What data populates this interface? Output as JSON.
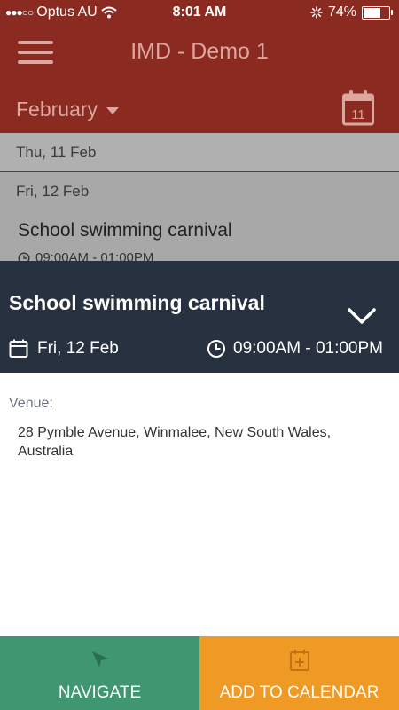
{
  "status_bar": {
    "carrier": "Optus AU",
    "time": "8:01 AM",
    "battery": "74%",
    "battery_level": 0.74
  },
  "header": {
    "title": "IMD - Demo 1",
    "month": "February",
    "calendar_day": "11"
  },
  "list": {
    "rows": [
      {
        "date": "Thu, 11 Feb"
      },
      {
        "date": "Fri, 12 Feb"
      }
    ],
    "event_title": "School swimming carnival",
    "event_time": "09:00AM - 01:00PM"
  },
  "detail": {
    "title": "School swimming carnival",
    "date": "Fri, 12 Feb",
    "time": "09:00AM - 01:00PM",
    "venue_label": "Venue:",
    "venue": "28 Pymble Avenue, Winmalee, New South Wales, Australia"
  },
  "actions": {
    "navigate": "NAVIGATE",
    "add_to_calendar": "ADD TO CALENDAR"
  },
  "colors": {
    "header_bg": "#8a2a20",
    "panel_bg": "#28313f",
    "navigate_bg": "#3f9671",
    "calendar_bg": "#f09a26"
  }
}
